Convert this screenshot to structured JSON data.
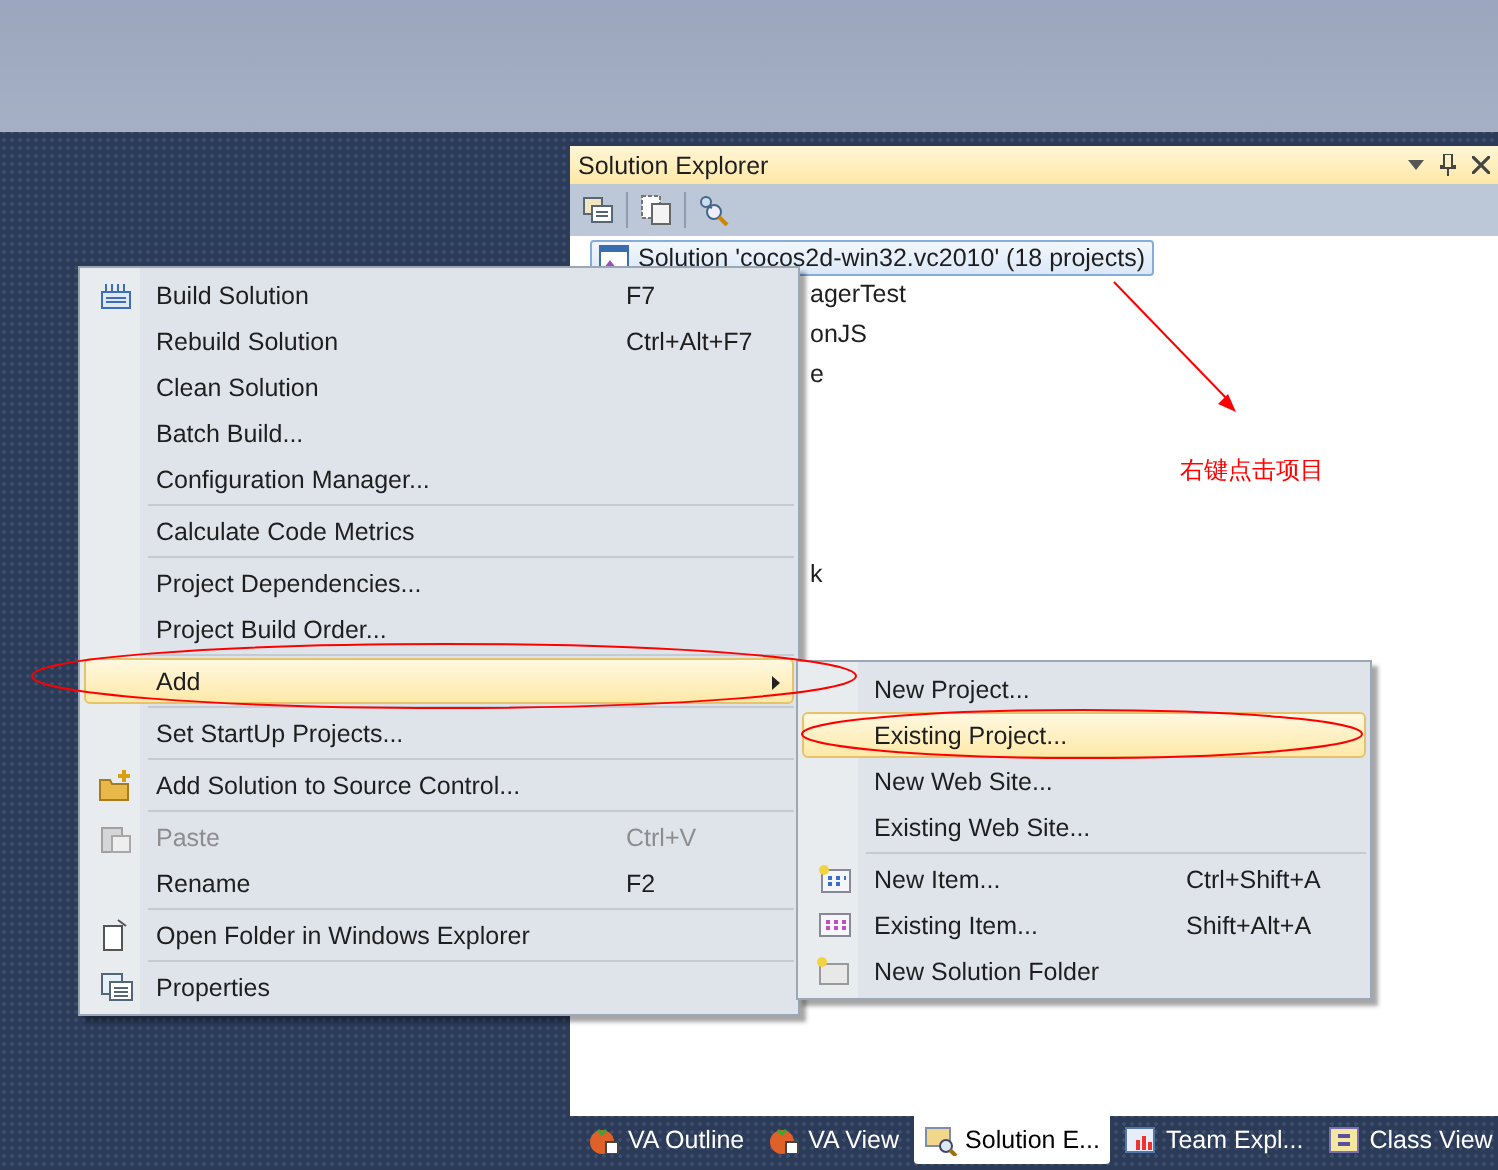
{
  "solution_explorer": {
    "title": "Solution Explorer",
    "tree": {
      "root": {
        "label": "Solution 'cocos2d-win32.vc2010' (18 projects)",
        "selected": true
      },
      "rows": [
        {
          "label": "agerTest"
        },
        {
          "label": "onJS"
        },
        {
          "label": "e"
        },
        {
          "label": "k"
        }
      ]
    },
    "annotation": {
      "note": "右键点击项目"
    },
    "bottom_tabs": [
      {
        "label": "VA Outline",
        "selected": false
      },
      {
        "label": "VA View",
        "selected": false
      },
      {
        "label": "Solution E...",
        "selected": true
      },
      {
        "label": "Team Expl...",
        "selected": false
      },
      {
        "label": "Class View",
        "selected": false
      }
    ]
  },
  "context_menu": {
    "items": [
      {
        "kind": "item",
        "label": "Build Solution",
        "shortcut": "F7",
        "disabled": false,
        "selected": false
      },
      {
        "kind": "item",
        "label": "Rebuild Solution",
        "shortcut": "Ctrl+Alt+F7",
        "disabled": false,
        "selected": false
      },
      {
        "kind": "item",
        "label": "Clean Solution",
        "disabled": false,
        "selected": false
      },
      {
        "kind": "item",
        "label": "Batch Build...",
        "disabled": false,
        "selected": false
      },
      {
        "kind": "item",
        "label": "Configuration Manager...",
        "disabled": false,
        "selected": false
      },
      {
        "kind": "separator"
      },
      {
        "kind": "item",
        "label": "Calculate Code Metrics",
        "disabled": false,
        "selected": false
      },
      {
        "kind": "separator"
      },
      {
        "kind": "item",
        "label": "Project Dependencies...",
        "disabled": false,
        "selected": false
      },
      {
        "kind": "item",
        "label": "Project Build Order...",
        "disabled": false,
        "selected": false
      },
      {
        "kind": "separator"
      },
      {
        "kind": "item",
        "label": "Add",
        "submenu": true,
        "disabled": false,
        "selected": true
      },
      {
        "kind": "separator"
      },
      {
        "kind": "item",
        "label": "Set StartUp Projects...",
        "disabled": false,
        "selected": false
      },
      {
        "kind": "separator"
      },
      {
        "kind": "item",
        "label": "Add Solution to Source Control...",
        "disabled": false,
        "selected": false
      },
      {
        "kind": "separator"
      },
      {
        "kind": "item",
        "label": "Paste",
        "shortcut": "Ctrl+V",
        "disabled": true,
        "selected": false
      },
      {
        "kind": "item",
        "label": "Rename",
        "shortcut": "F2",
        "disabled": false,
        "selected": false
      },
      {
        "kind": "separator"
      },
      {
        "kind": "item",
        "label": "Open Folder in Windows Explorer",
        "disabled": false,
        "selected": false
      },
      {
        "kind": "separator"
      },
      {
        "kind": "item",
        "label": "Properties",
        "disabled": false,
        "selected": false
      }
    ]
  },
  "add_submenu": {
    "items": [
      {
        "kind": "item",
        "label": "New Project...",
        "disabled": false,
        "selected": false
      },
      {
        "kind": "item",
        "label": "Existing Project...",
        "disabled": false,
        "selected": true
      },
      {
        "kind": "item",
        "label": "New Web Site...",
        "disabled": false,
        "selected": false
      },
      {
        "kind": "item",
        "label": "Existing Web Site...",
        "disabled": false,
        "selected": false
      },
      {
        "kind": "separator"
      },
      {
        "kind": "item",
        "label": "New Item...",
        "shortcut": "Ctrl+Shift+A",
        "disabled": false,
        "selected": false
      },
      {
        "kind": "item",
        "label": "Existing Item...",
        "shortcut": "Shift+Alt+A",
        "disabled": false,
        "selected": false
      },
      {
        "kind": "item",
        "label": "New Solution Folder",
        "disabled": false,
        "selected": false
      }
    ]
  }
}
